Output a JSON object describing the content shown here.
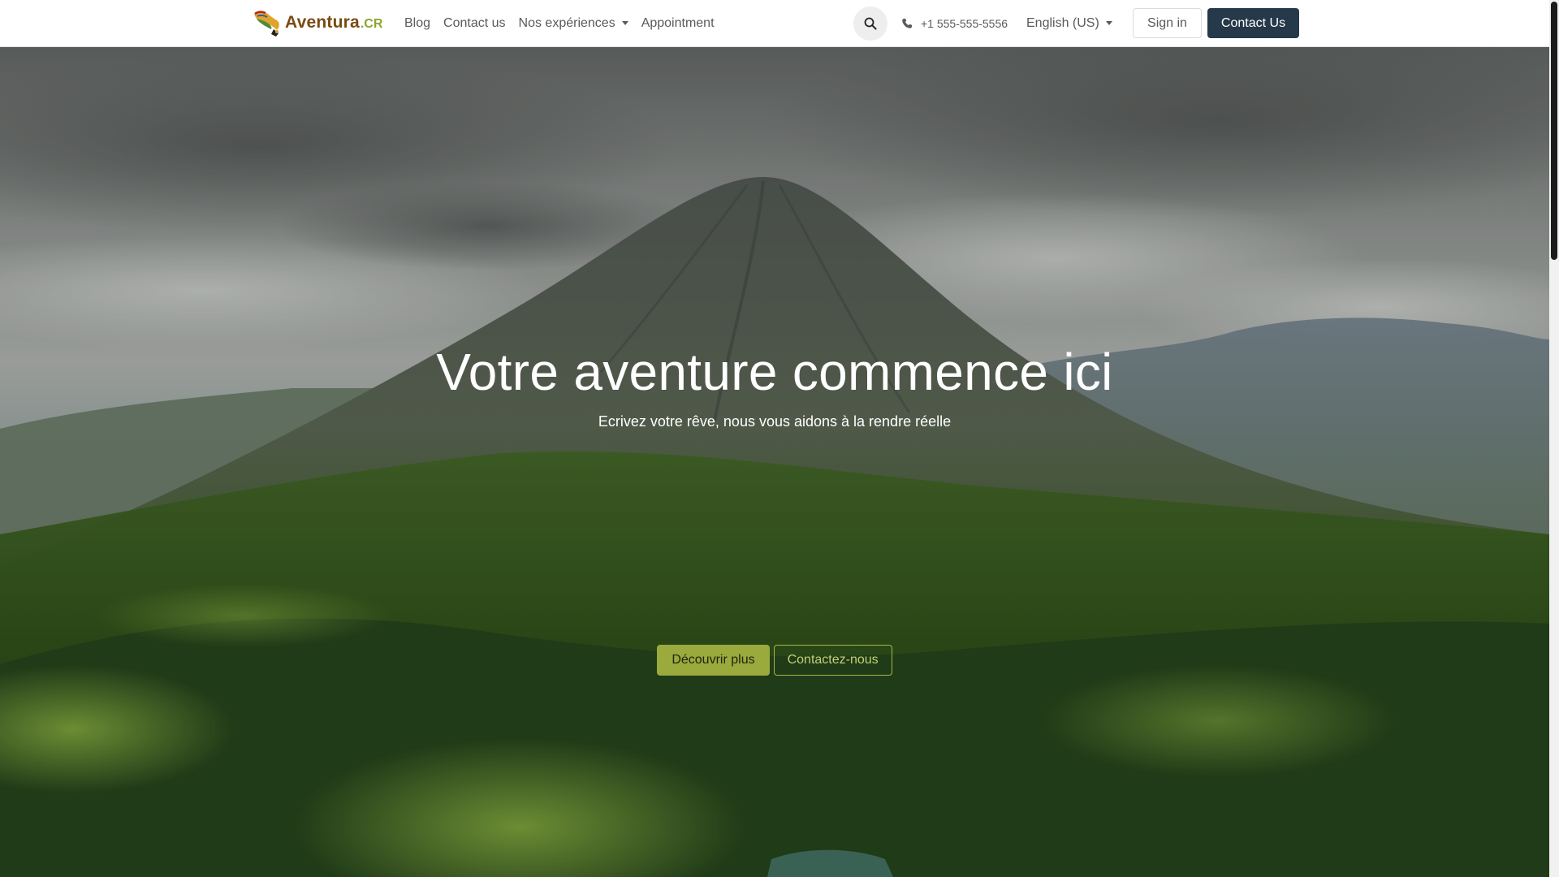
{
  "header": {
    "brand": {
      "name": "Aventura",
      "suffix": ".CR"
    },
    "nav": [
      {
        "label": "Blog",
        "dropdown": false
      },
      {
        "label": "Contact us",
        "dropdown": false
      },
      {
        "label": "Nos expériences",
        "dropdown": true
      },
      {
        "label": "Appointment",
        "dropdown": false
      }
    ],
    "search_icon": "search-icon",
    "phone": {
      "icon": "phone-icon",
      "number": "+1 555-555-5556"
    },
    "language": {
      "label": "English (US)"
    },
    "sign_in_label": "Sign in",
    "contact_button_label": "Contact Us"
  },
  "hero": {
    "title": "Votre aventure commence ici",
    "subtitle": "Ecrivez votre rêve, nous vous aidons à la rendre réelle",
    "primary_button": "Découvrir plus",
    "secondary_button": "Contactez-nous"
  },
  "colors": {
    "header_bg": "#ffffff",
    "nav_text": "#5a5a5a",
    "brand_text": "#7a4a12",
    "brand_accent": "#8aa52c",
    "contact_button_bg": "#26394a",
    "primary_button_bg": "#9aaa3c",
    "outline_button_border": "#a6b648"
  }
}
